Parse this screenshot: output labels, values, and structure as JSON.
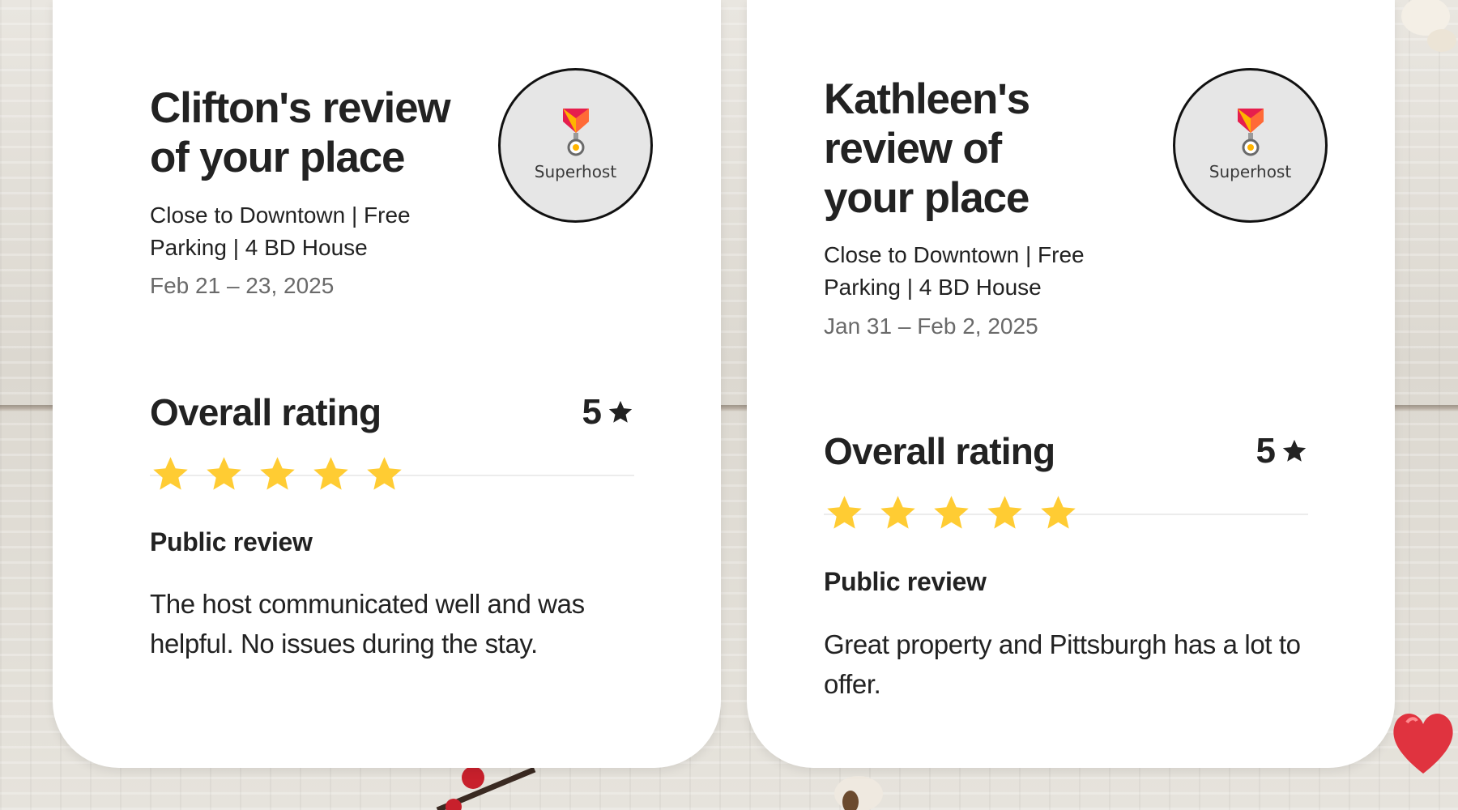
{
  "reviews": [
    {
      "title": "Clifton's review of your place",
      "listing": "Close to Downtown | Free Parking | 4 BD House",
      "dates": "Feb 21 – 23, 2025",
      "badge_label": "Superhost",
      "rating_label": "Overall rating",
      "rating_value": "5",
      "stars": 5,
      "public_review_label": "Public review",
      "public_review_text": "The host communicated well and was helpful. No issues during the stay."
    },
    {
      "title": "Kathleen's review of your place",
      "listing": "Close to Downtown | Free Parking | 4 BD House",
      "dates": "Jan 31 – Feb 2, 2025",
      "badge_label": "Superhost",
      "rating_label": "Overall rating",
      "rating_value": "5",
      "stars": 5,
      "public_review_label": "Public review",
      "public_review_text": "Great property and Pittsburgh has a lot to offer."
    }
  ],
  "icons": {
    "badge": "superhost-medal-icon",
    "rating": "star-icon"
  },
  "colors": {
    "star_fill": "#FFCC33",
    "medal_red": "#E61E4D",
    "medal_orange": "#FFB400"
  }
}
